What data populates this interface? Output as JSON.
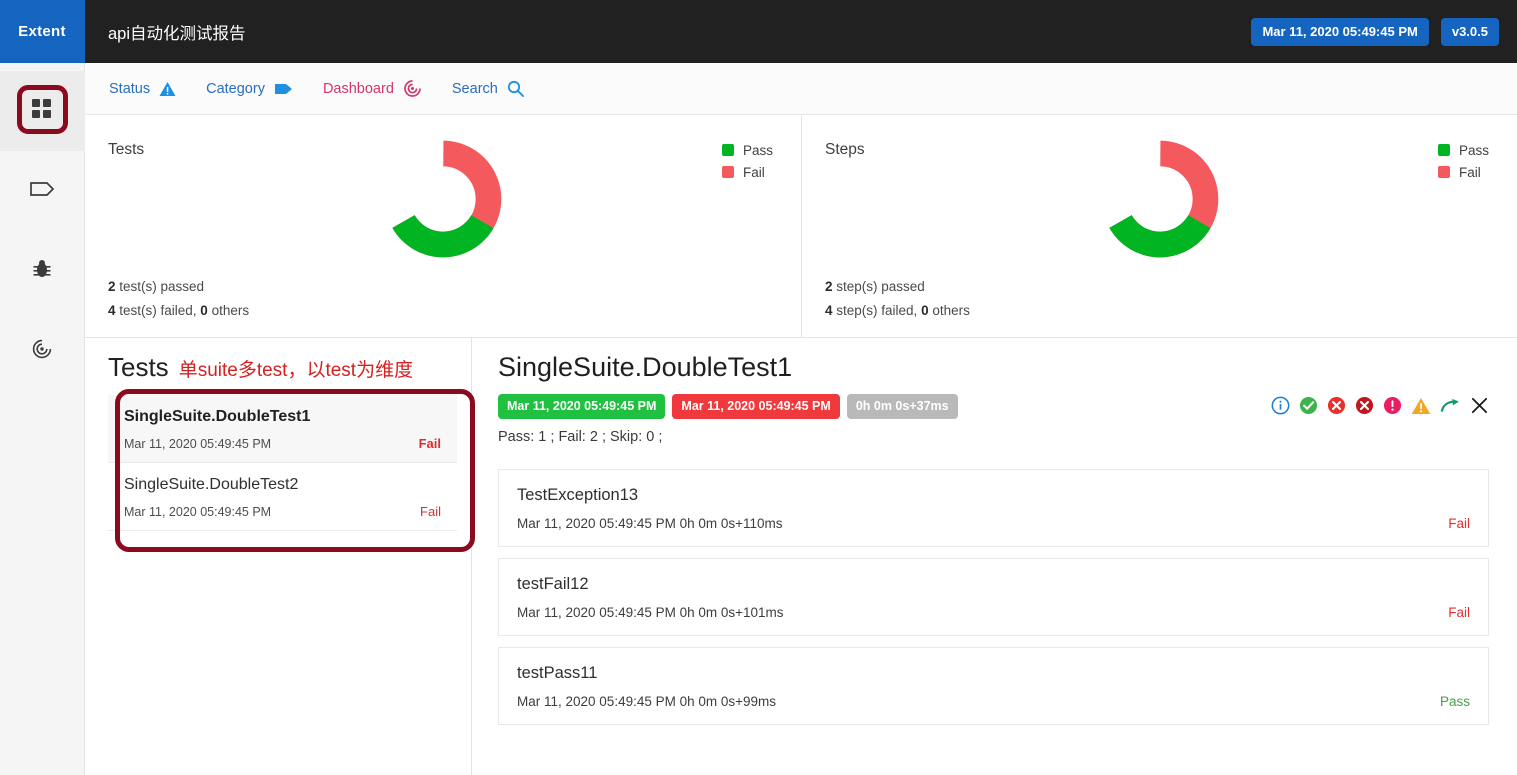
{
  "brand": {
    "label": "Extent"
  },
  "topbar": {
    "title": "api自动化测试报告",
    "timestamp_badge": "Mar 11, 2020 05:49:45 PM",
    "version_badge": "v3.0.5"
  },
  "sidebar": {
    "items": [
      {
        "label": "Dashboard",
        "icon": "grid-icon",
        "active": true
      },
      {
        "label": "Categories",
        "icon": "tag-icon",
        "active": false
      },
      {
        "label": "Exceptions",
        "icon": "bug-icon",
        "active": false
      },
      {
        "label": "Dashboard Target",
        "icon": "target-icon",
        "active": false
      }
    ]
  },
  "nav": {
    "tabs": [
      {
        "label": "Status",
        "icon": "warning-triangle-icon",
        "active": false
      },
      {
        "label": "Category",
        "icon": "tag-icon",
        "active": false
      },
      {
        "label": "Dashboard",
        "icon": "target-icon",
        "active": true
      },
      {
        "label": "Search",
        "icon": "search-icon",
        "active": false
      }
    ]
  },
  "colors": {
    "pass": "#00b521",
    "fail": "#f4595e",
    "accent_blue": "#1565c0",
    "accent_pink": "#d6336c",
    "highlight_box": "#8b0a1e"
  },
  "chart_data": [
    {
      "type": "pie",
      "title": "Tests",
      "categories": [
        "Pass",
        "Fail"
      ],
      "values": [
        2,
        4
      ],
      "colors": [
        "#00b521",
        "#f4595e"
      ],
      "legend": [
        "Pass",
        "Fail"
      ],
      "legend_position": "right",
      "donut": true,
      "stats": {
        "passed_count": "2",
        "passed_text": " test(s) passed",
        "failed_count": "4",
        "failed_text": " test(s) failed, ",
        "others_count": "0",
        "others_text": " others"
      }
    },
    {
      "type": "pie",
      "title": "Steps",
      "categories": [
        "Pass",
        "Fail"
      ],
      "values": [
        2,
        4
      ],
      "colors": [
        "#00b521",
        "#f4595e"
      ],
      "legend": [
        "Pass",
        "Fail"
      ],
      "legend_position": "right",
      "donut": true,
      "stats": {
        "passed_count": "2",
        "passed_text": " step(s) passed",
        "failed_count": "4",
        "failed_text": " step(s) failed, ",
        "others_count": "0",
        "others_text": " others"
      }
    }
  ],
  "tests_pane": {
    "heading": "Tests",
    "annotation": "单suite多test，以test为维度",
    "items": [
      {
        "name": "SingleSuite.DoubleTest1",
        "date": "Mar 11, 2020 05:49:45 PM",
        "status": "Fail",
        "selected": true
      },
      {
        "name": "SingleSuite.DoubleTest2",
        "date": "Mar 11, 2020 05:49:45 PM",
        "status": "Fail",
        "selected": false
      }
    ]
  },
  "detail": {
    "title": "SingleSuite.DoubleTest1",
    "start_badge": "Mar 11, 2020 05:49:45 PM",
    "end_badge": "Mar 11, 2020 05:49:45 PM",
    "duration_badge": "0h 0m 0s+37ms",
    "counts": "Pass: 1 ; Fail: 2 ; Skip: 0 ;",
    "icons": [
      {
        "name": "info-icon",
        "color": "#1d7fd4"
      },
      {
        "name": "check-circle-icon",
        "color": "#3cb44b"
      },
      {
        "name": "error-circle-icon",
        "color": "#e8312f"
      },
      {
        "name": "fatal-circle-icon",
        "color": "#c1161b"
      },
      {
        "name": "exclamation-circle-icon",
        "color": "#e91e63"
      },
      {
        "name": "warning-triangle-icon",
        "color": "#f5a623"
      },
      {
        "name": "skip-arrow-icon",
        "color": "#0f9b6c"
      },
      {
        "name": "close-icon",
        "color": "#1a1a1a"
      }
    ],
    "steps": [
      {
        "name": "TestException13",
        "date": "Mar 11, 2020 05:49:45 PM",
        "duration": "0h 0m 0s+110ms",
        "status": "Fail"
      },
      {
        "name": "testFail12",
        "date": "Mar 11, 2020 05:49:45 PM",
        "duration": "0h 0m 0s+101ms",
        "status": "Fail"
      },
      {
        "name": "testPass11",
        "date": "Mar 11, 2020 05:49:45 PM",
        "duration": "0h 0m 0s+99ms",
        "status": "Pass"
      }
    ]
  }
}
